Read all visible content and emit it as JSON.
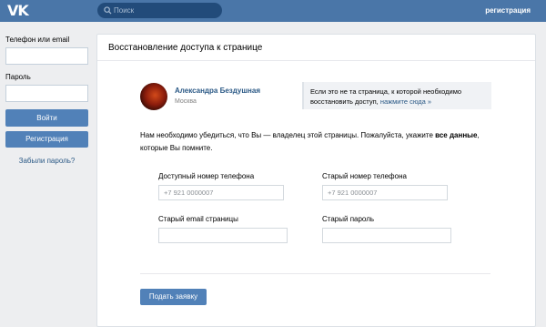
{
  "header": {
    "logo": "VK",
    "search_placeholder": "Поиск",
    "register_link": "регистрация"
  },
  "login": {
    "phone_label": "Телефон или email",
    "password_label": "Пароль",
    "login_button": "Войти",
    "register_button": "Регистрация",
    "forgot_link": "Забыли пароль?"
  },
  "panel": {
    "title": "Восстановление доступа к странице",
    "user": {
      "name": "Александра Бездушная",
      "city": "Москва"
    },
    "hint": {
      "text": "Если это не та страница, к которой необходимо восстановить доступ,",
      "link": "нажмите сюда »"
    },
    "notice": {
      "text_before": "Нам необходимо убедиться, что Вы — владелец этой страницы. Пожалуйста, укажите ",
      "bold": "все данные",
      "text_after": ", которые Вы помните."
    },
    "fields": {
      "phone_label": "Доступный номер телефона",
      "phone_placeholder": "+7 921 0000007",
      "old_phone_label": "Старый номер телефона",
      "old_phone_placeholder": "+7 921 0000007",
      "old_email_label": "Старый email страницы",
      "old_password_label": "Старый пароль"
    },
    "submit_button": "Подать заявку"
  },
  "colors": {
    "header": "#4a76a8",
    "button": "#5181b8",
    "link": "#2a5885",
    "background": "#edeef0"
  }
}
